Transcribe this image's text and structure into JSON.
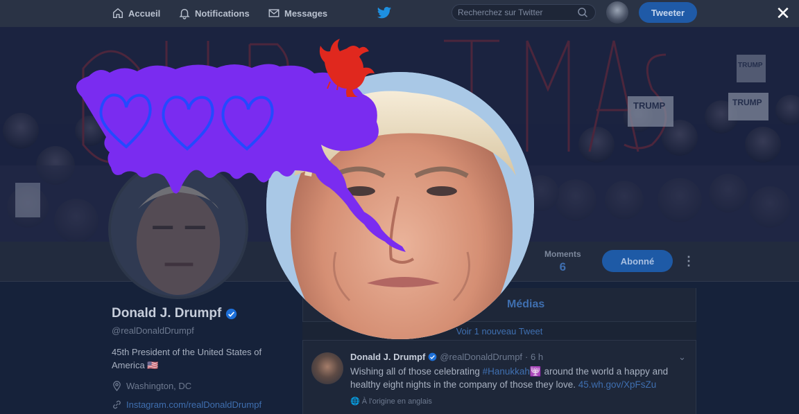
{
  "nav": {
    "home": "Accueil",
    "notifications": "Notifications",
    "messages": "Messages",
    "search_placeholder": "Recherchez sur Twitter",
    "tweet_button": "Tweeter",
    "close": "✕"
  },
  "profile": {
    "name": "Donald J. Drumpf",
    "handle": "@realDonaldDrumpf",
    "bio": "45th President of the United States of America",
    "flag": "🇺🇸",
    "location": "Washington, DC",
    "link": "Instagram.com/realDonaldDrumpf",
    "stats": [
      {
        "label": "Moments",
        "value": "6"
      }
    ],
    "follow_button": "Abonné",
    "more": "⋮"
  },
  "timeline": {
    "tab_label": "Médias",
    "new_tweets": "Voir 1 nouveau Tweet",
    "tweet": {
      "name": "Donald J. Drumpf",
      "handle": "@realDonaldDrumpf",
      "time": "· 6 h",
      "text_before": "Wishing all of those celebrating ",
      "hashtag": "#Hanukkah",
      "emoji": "🕎",
      "text_after": " around the world a happy and healthy eight nights in the company of those they love. ",
      "link": "45.wh.gov/XpFsZu",
      "origin": "À l'origine en anglais"
    }
  },
  "banner": {
    "word": "CHRISTMAS",
    "signs": [
      "TRUMP",
      "TRUMP",
      "TRUMP"
    ]
  },
  "colors": {
    "accent": "#1f5aa7",
    "bubble": "#7a2cf0",
    "hearts": "#2449ff",
    "rooster": "#e0281e"
  },
  "icons": {
    "home": "home-icon",
    "notifications": "bell-icon",
    "messages": "envelope-icon",
    "search": "search-icon",
    "verified": "verified-badge-icon",
    "location": "location-pin-icon",
    "link": "link-icon"
  }
}
